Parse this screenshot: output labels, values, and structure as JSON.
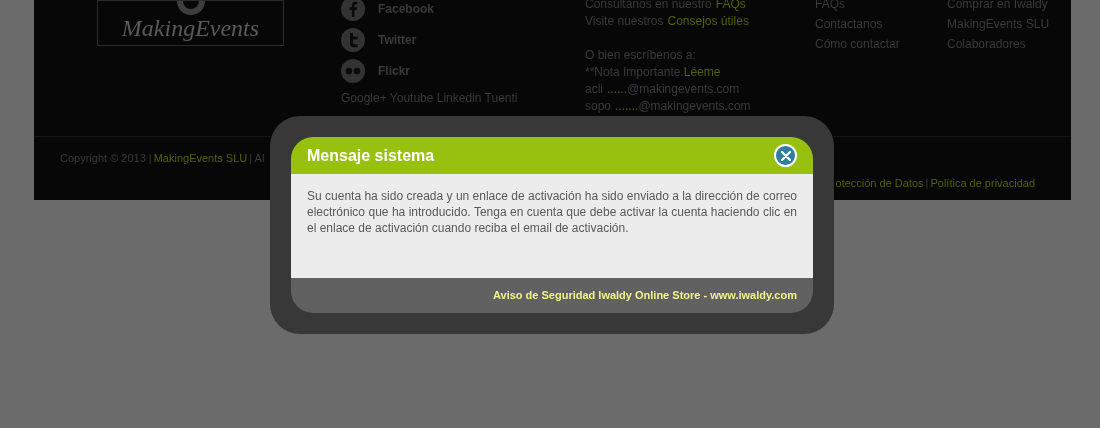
{
  "footer": {
    "logo": {
      "text": "MakingEvents"
    },
    "social": [
      {
        "kind": "facebook",
        "label": "Facebook"
      },
      {
        "kind": "twitter",
        "label": "Twitter"
      },
      {
        "kind": "flickr",
        "label": "Flickr"
      }
    ],
    "more_networks": "Google+ Youtube Linkedin Tuenti",
    "contact_lines": [
      {
        "gap_before": false,
        "parts": [
          {
            "text": "Consúltanos en nuestro",
            "link": false
          },
          {
            "text": "FAQs",
            "link": true
          }
        ]
      },
      {
        "gap_before": false,
        "parts": [
          {
            "text": "Visite nuestros",
            "link": false
          },
          {
            "text": "Consejos útiles",
            "link": true
          }
        ]
      },
      {
        "gap_before": true,
        "parts": [
          {
            "text": "O bien escríbenos a:",
            "link": false
          }
        ]
      },
      {
        "gap_before": false,
        "parts": [
          {
            "text": "**Nota Importante.",
            "link": false
          },
          {
            "text": "Léeme",
            "link": true
          }
        ]
      },
      {
        "gap_before": false,
        "parts": [
          {
            "text": "acli",
            "link": false
          },
          {
            "text": "......",
            "link": true
          },
          {
            "text": "@makingevents.com",
            "link": false
          }
        ]
      },
      {
        "gap_before": false,
        "parts": [
          {
            "text": "sopo",
            "link": false
          },
          {
            "text": ".......",
            "link": true
          },
          {
            "text": "@makingevents.com",
            "link": false
          }
        ]
      }
    ],
    "links_1": [
      "FAQs",
      "Contactanos",
      "Cómo contactar"
    ],
    "links_2": [
      "Comprar en Iwaldy",
      "MakingEvents SLU",
      "Colaboradores"
    ],
    "copyright": [
      {
        "text": "Copyright © 2013 |",
        "link": false
      },
      {
        "text": "MakingEvents SLU",
        "link": true
      },
      {
        "text": "| Al",
        "link": false
      }
    ],
    "legal": [
      {
        "text": "otección de Datos",
        "link": true
      },
      {
        "text": "|",
        "link": false
      },
      {
        "text": "Política de privacidad",
        "link": true
      }
    ]
  },
  "dialog": {
    "title": "Mensaje sistema",
    "message": "Su cuenta ha sido creada y un enlace de activación ha sido enviado a la dirección de correo electrónico que ha introducido. Tenga en cuenta que debe activar la cuenta haciendo clic en el enlace de activación cuando reciba el email de activación.",
    "footer_note": "Aviso de Seguridad Iwaldy Online Store - www.iwaldy.com"
  }
}
